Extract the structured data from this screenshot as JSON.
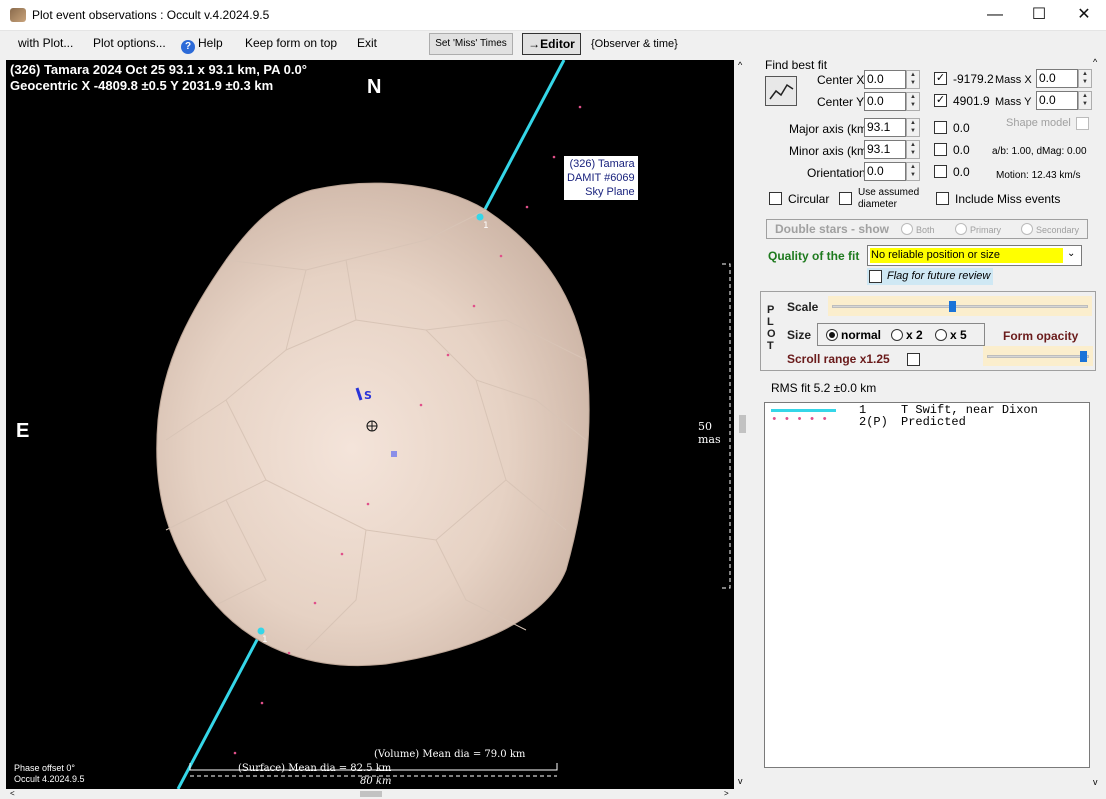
{
  "window": {
    "title": "Plot event observations : Occult v.4.2024.9.5",
    "controls": {
      "minimize": "—",
      "maximize": "☐",
      "close": "✕"
    }
  },
  "menu": {
    "with_plot": "with Plot...",
    "plot_options": "Plot options...",
    "help": "Help",
    "keep_on_top": "Keep form on top",
    "exit": "Exit",
    "set_miss_times": "Set 'Miss' Times",
    "editor": "→Editor",
    "observer_time": "{Observer & time}"
  },
  "plot": {
    "header_line1": "(326) Tamara  2024 Oct 25   93.1 x 93.1 km, PA 0.0°",
    "header_line2": "Geocentric  X  -4809.8 ±0.5  Y 2031.9 ±0.3 km",
    "north": "N",
    "east": "E",
    "label_line1": "(326) Tamara",
    "label_line2": "DAMIT #6069",
    "label_line3": "Sky Plane",
    "scale_mas": "50 mas",
    "phase_offset": "Phase offset 0°",
    "occult_version": "Occult 4.2024.9.5",
    "volume_dia": "(Volume) Mean dia = 79.0 km",
    "surface_dia": "(Surface) Mean dia = 82.5 km",
    "km_scale": "80 km",
    "chord_label": "1",
    "s_marker": "S",
    "colors": {
      "chord": "#35d6e8",
      "predicted": "#e0508a",
      "background": "#000000"
    }
  },
  "fit": {
    "find_best_fit": "Find best fit",
    "center_x_label": "Center X",
    "center_x": "0.0",
    "center_y_label": "Center Y",
    "center_y": "0.0",
    "x_value": "-9179.2",
    "y_value": "4901.9",
    "mass_x_label": "Mass X",
    "mass_x": "0.0",
    "mass_y_label": "Mass Y",
    "mass_y": "0.0",
    "major_axis_label": "Major axis (km)",
    "major_axis": "93.1",
    "minor_axis_label": "Minor axis (km)",
    "minor_axis": "93.1",
    "orientation_label": "Orientation",
    "orientation": "0.0",
    "chk_major_value": "0.0",
    "chk_minor_value": "0.0",
    "chk_orient_value": "0.0",
    "shape_model": "Shape model",
    "ab_dmag": "a/b: 1.00, dMag: 0.00",
    "motion": "Motion: 12.43 km/s",
    "circular": "Circular",
    "use_assumed_1": "Use assumed",
    "use_assumed_2": "diameter",
    "include_miss": "Include Miss events",
    "double_stars": "Double stars - show",
    "both": "Both",
    "primary": "Primary",
    "secondary": "Secondary",
    "quality_label": "Quality of the fit",
    "quality_value": "No reliable position or size",
    "flag_review": "Flag for future review"
  },
  "plotctl": {
    "p_letters": "P L O T",
    "scale": "Scale",
    "scale_level": 0.47,
    "size": "Size",
    "size_normal": "normal",
    "size_x2": "x 2",
    "size_x5": "x 5",
    "form_opacity": "Form opacity",
    "opacity_level": 0.98,
    "scroll_range": "Scroll range x1.25"
  },
  "rms": "RMS fit 5.2 ±0.0 km",
  "legend": [
    {
      "id": "1",
      "text": "T Swift, near Dixon"
    },
    {
      "id": "2(P)",
      "text": "Predicted"
    }
  ]
}
